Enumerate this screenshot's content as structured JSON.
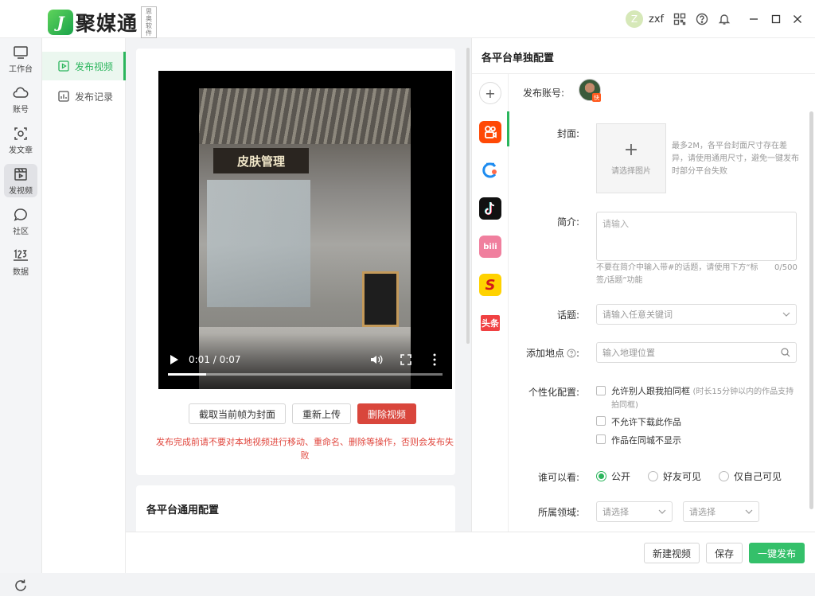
{
  "app": {
    "logo_mark": "J",
    "name": "聚媒通",
    "sub_badge": "思奥软件"
  },
  "user": {
    "avatar_letter": "Z",
    "name": "zxf"
  },
  "leftnav": [
    {
      "label": "工作台"
    },
    {
      "label": "账号"
    },
    {
      "label": "发文章"
    },
    {
      "label": "发视频"
    },
    {
      "label": "社区"
    },
    {
      "label": "数据"
    }
  ],
  "subnav": [
    {
      "label": "发布视频"
    },
    {
      "label": "发布记录"
    }
  ],
  "video": {
    "sign_text": "皮肤管理",
    "time": "0:01 / 0:07",
    "progress": 0.14
  },
  "video_actions": {
    "capture": "截取当前帧为封面",
    "reupload": "重新上传",
    "delete": "删除视频"
  },
  "warning": "发布完成前请不要对本地视频进行移动、重命名、删除等操作，否则会发布失败",
  "common_config": {
    "title": "各平台通用配置"
  },
  "per_platform": {
    "title": "各平台单独配置",
    "add": "+",
    "platforms": [
      {
        "name": "快手",
        "color": "#ff4906",
        "glyph": "快"
      },
      {
        "name": "QQ",
        "color": "#ffffff",
        "glyph": "C"
      },
      {
        "name": "抖音",
        "color": "#111111",
        "glyph": "♪"
      },
      {
        "name": "哔哩哔哩",
        "color": "#f07f9e",
        "glyph": "bili"
      },
      {
        "name": "搜狐",
        "color": "#ffd200",
        "glyph": "S"
      },
      {
        "name": "头条",
        "color": "#ffffff",
        "glyph": "头条"
      }
    ],
    "account_label": "发布账号:",
    "account_badge": "快",
    "cover_label": "封面:",
    "cover_placeholder": "请选择图片",
    "cover_hint": "最多2M，各平台封面尺寸存在差异，请使用通用尺寸，避免一键发布时部分平台失败",
    "intro_label": "简介:",
    "intro_placeholder": "请输入",
    "intro_hint": "不要在简介中输入带#的话题，请使用下方“标签/话题”功能",
    "intro_count": "0/500",
    "topic_label": "话题:",
    "topic_placeholder": "请输入任意关键词",
    "location_label": "添加地点",
    "location_placeholder": "输入地理位置",
    "personal_label": "个性化配置:",
    "options": [
      {
        "label": "允许别人跟我拍同框",
        "note": "(时长15分钟以内的作品支持拍同框)"
      },
      {
        "label": "不允许下载此作品",
        "note": ""
      },
      {
        "label": "作品在同城不显示",
        "note": ""
      }
    ],
    "visibility_label": "谁可以看:",
    "visibility": [
      "公开",
      "好友可见",
      "仅自己可见"
    ],
    "visibility_selected": "公开",
    "domain_label": "所属领域:",
    "domain_placeholder_1": "请选择",
    "domain_placeholder_2": "请选择"
  },
  "bottom": {
    "new_video": "新建视频",
    "save": "保存",
    "publish": "一键发布"
  },
  "colors": {
    "accent": "#2bb55c",
    "danger": "#d9463c",
    "primary_button": "#34c06a"
  }
}
